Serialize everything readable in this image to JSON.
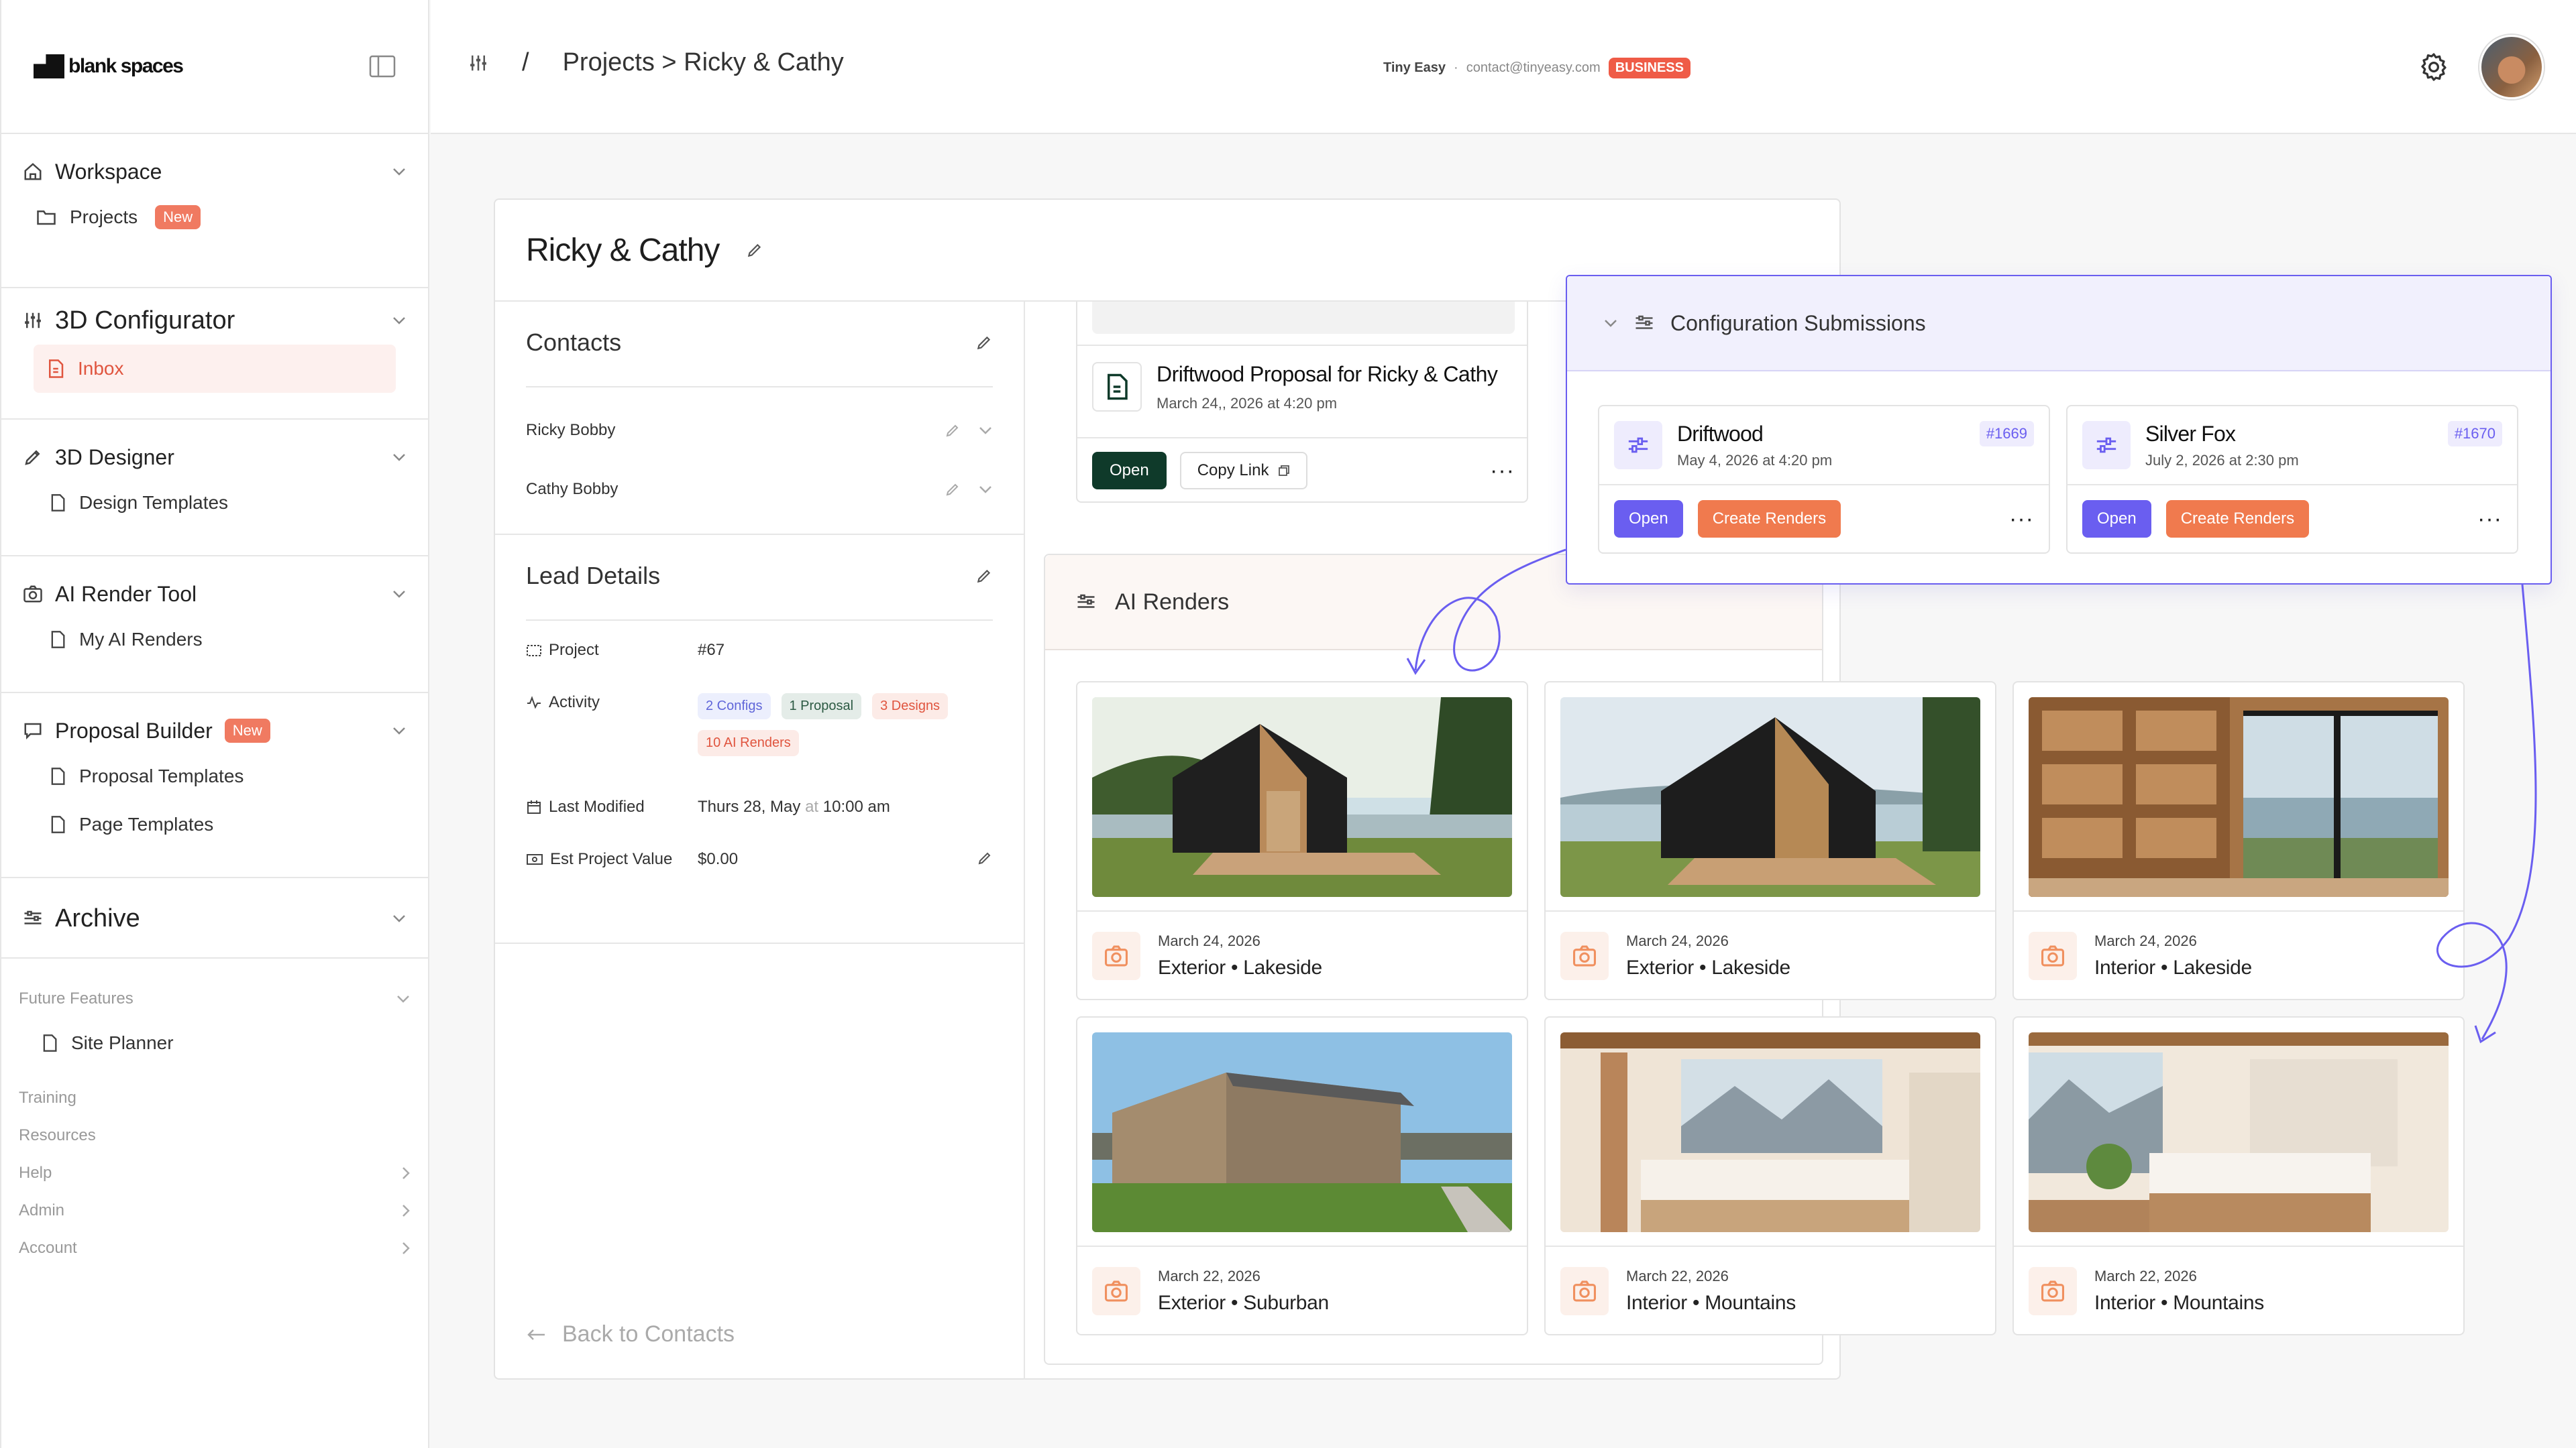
{
  "sidebar": {
    "brand": "blank spaces",
    "sections": [
      {
        "title": "Workspace",
        "items": [
          {
            "label": "Projects",
            "badge": "New"
          }
        ]
      },
      {
        "title": "3D Configurator",
        "items": [
          {
            "label": "Inbox"
          }
        ]
      },
      {
        "title": "3D Designer",
        "items": [
          {
            "label": "Design Templates"
          }
        ]
      },
      {
        "title": "AI Render Tool",
        "items": [
          {
            "label": "My AI Renders"
          }
        ]
      },
      {
        "title": "Proposal Builder",
        "badge": "New",
        "items": [
          {
            "label": "Proposal Templates"
          },
          {
            "label": "Page Templates"
          }
        ]
      },
      {
        "title": "Archive"
      }
    ],
    "future": {
      "title": "Future Features",
      "item": "Site Planner"
    },
    "links": [
      "Training",
      "Resources",
      "Help",
      "Admin",
      "Account"
    ]
  },
  "topbar": {
    "breadcrumb_sep": "/",
    "breadcrumb": "Projects > Ricky & Cathy",
    "org_name": "Tiny Easy",
    "org_sep": "·",
    "org_email": "contact@tinyeasy.com",
    "plan": "BUSINESS"
  },
  "project": {
    "title": "Ricky & Cathy",
    "contacts_title": "Contacts",
    "contacts": [
      "Ricky Bobby",
      "Cathy Bobby"
    ],
    "lead_title": "Lead Details",
    "lead": {
      "project_label": "Project",
      "project_value": "#67",
      "activity_label": "Activity",
      "chips": {
        "configs": "2 Configs",
        "proposal": "1 Proposal",
        "designs": "3 Designs",
        "renders": "10 AI Renders"
      },
      "modified_label": "Last Modified",
      "modified_day": "Thurs 28, May",
      "modified_at": "at",
      "modified_time": "10:00 am",
      "value_label": "Est Project Value",
      "value": "$0.00"
    },
    "back": "Back to Contacts"
  },
  "proposal": {
    "title": "Driftwood Proposal for Ricky & Cathy",
    "date": "March 24,, 2026 at 4:20 pm",
    "open": "Open",
    "copy_link": "Copy Link"
  },
  "renders": {
    "title": "AI Renders",
    "items": [
      {
        "date": "March 24, 2026",
        "name": "Exterior • Lakeside"
      },
      {
        "date": "March 24, 2026",
        "name": "Exterior • Lakeside"
      },
      {
        "date": "March 24, 2026",
        "name": "Interior • Lakeside"
      },
      {
        "date": "March 22, 2026",
        "name": "Exterior • Suburban"
      },
      {
        "date": "March 22, 2026",
        "name": "Interior • Mountains"
      },
      {
        "date": "March 22, 2026",
        "name": "Interior • Mountains"
      }
    ]
  },
  "config": {
    "title": "Configuration Submissions",
    "submissions": [
      {
        "name": "Driftwood",
        "date": "May 4, 2026 at 4:20 pm",
        "id": "#1669",
        "open": "Open",
        "create": "Create Renders"
      },
      {
        "name": "Silver Fox",
        "date": "July 2, 2026 at 2:30 pm",
        "id": "#1670",
        "open": "Open",
        "create": "Create Renders"
      }
    ]
  },
  "colors": {
    "accent": "#ef5b47",
    "purple": "#6a5ef0",
    "dark_green": "#0f3a2a",
    "orange": "#f07a4e"
  }
}
